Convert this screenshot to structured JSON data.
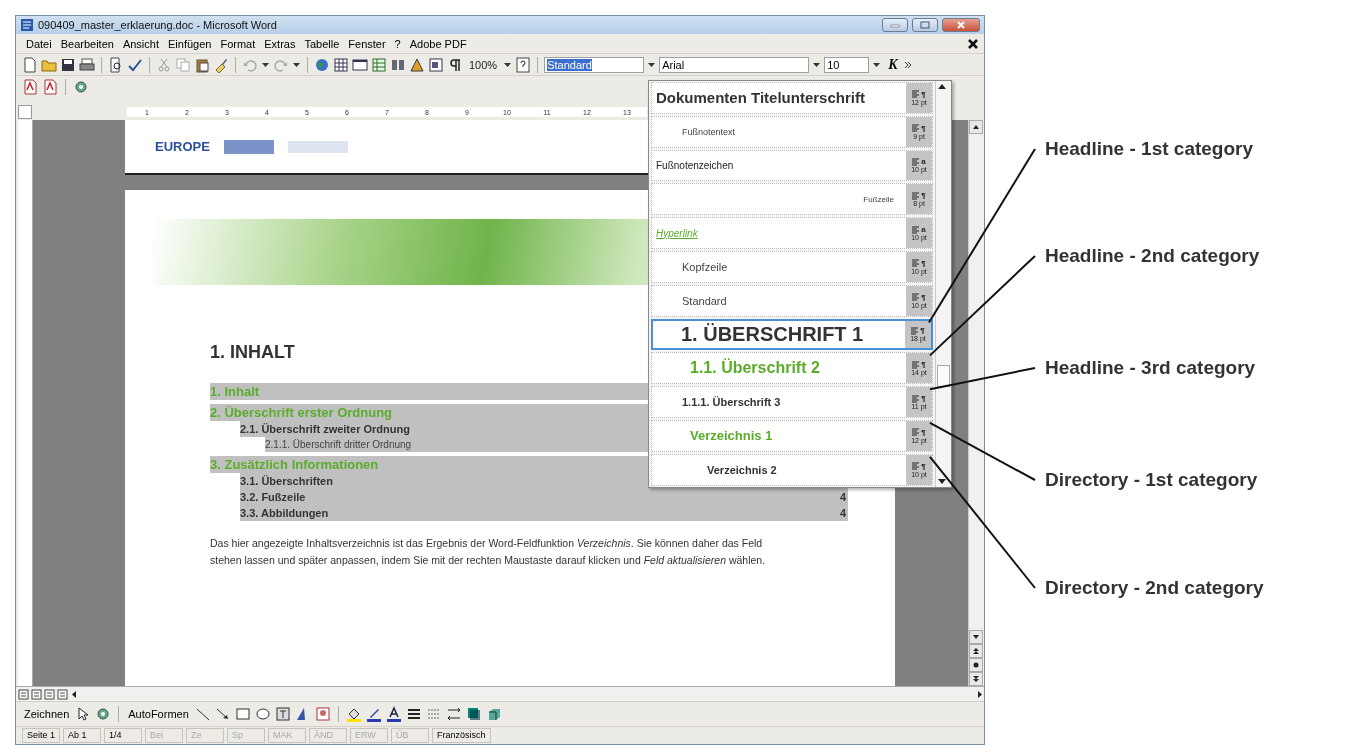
{
  "window": {
    "title": "090409_master_erklaerung.doc - Microsoft Word"
  },
  "menu": [
    "Datei",
    "Bearbeiten",
    "Ansicht",
    "Einfügen",
    "Format",
    "Extras",
    "Tabelle",
    "Fenster",
    "?",
    "Adobe PDF"
  ],
  "standard_toolbar": {
    "zoom": "100%"
  },
  "formatting_toolbar": {
    "style": "Standard",
    "font": "Arial",
    "size": "10",
    "italic_button": "K"
  },
  "ruler": {
    "marks": [
      "1",
      "2",
      "3",
      "4",
      "5",
      "6",
      "7",
      "8",
      "9",
      "10",
      "11",
      "12",
      "13"
    ]
  },
  "document": {
    "logo_text": "EUROPE",
    "heading": "1. INHALT",
    "toc": [
      {
        "text": "1. Inhalt"
      },
      {
        "text": "2. Überschrift erster Ordnung",
        "children": [
          {
            "text": "2.1. Überschrift zweiter Ordnung",
            "children": [
              {
                "text": "2.1.1. Überschrift dritter Ordnung"
              }
            ]
          }
        ]
      },
      {
        "text": "3. Zusätzlich Informationen",
        "children": [
          {
            "text": "3.1. Überschriften"
          },
          {
            "text": "3.2. Fußzeile",
            "page": "4"
          },
          {
            "text": "3.3. Abbildungen",
            "page": "4"
          }
        ]
      }
    ],
    "paragraph": "Das hier angezeigte Inhaltsverzeichnis ist das Ergebnis der Word-Feldfunktion *Verzeichnis*. Sie können daher das Feld stehen lassen und später anpassen, indem Sie mit der rechten Maustaste darauf klicken und *Feld aktualisieren* wählen."
  },
  "style_list": {
    "items": [
      {
        "label": "Dokumenten Titelunterschrift",
        "kind": "title",
        "marker": "¶",
        "size": "12 pt",
        "selected": false
      },
      {
        "label": "Fußnotentext",
        "kind": "footnote-text",
        "marker": "¶",
        "size": "9 pt",
        "selected": false
      },
      {
        "label": "Fußnotenzeichen",
        "kind": "footnote-mark",
        "marker": "a",
        "size": "10 pt",
        "selected": false
      },
      {
        "label": "Fußzeile",
        "kind": "footer",
        "marker": "¶",
        "size": "8 pt",
        "selected": false
      },
      {
        "label": "Hyperlink",
        "kind": "hyperlink",
        "marker": "a",
        "size": "10 pt",
        "selected": false
      },
      {
        "label": "Kopfzeile",
        "kind": "header",
        "marker": "¶",
        "size": "10 pt",
        "selected": false
      },
      {
        "label": "Standard",
        "kind": "normal",
        "marker": "¶",
        "size": "10 pt",
        "selected": false
      },
      {
        "label": "1.  ÜBERSCHRIFT 1",
        "kind": "h1",
        "marker": "¶",
        "size": "18 pt",
        "selected": true
      },
      {
        "label": "1.1.  Überschrift 2",
        "kind": "h2",
        "marker": "¶",
        "size": "14 pt",
        "selected": false
      },
      {
        "label": "1.1.1.  Überschrift 3",
        "kind": "h3",
        "marker": "¶",
        "size": "11 pt",
        "selected": false
      },
      {
        "label": "Verzeichnis 1",
        "kind": "toc1",
        "marker": "¶",
        "size": "12 pt",
        "selected": false
      },
      {
        "label": "Verzeichnis 2",
        "kind": "toc2",
        "marker": "¶",
        "size": "10 pt",
        "selected": false
      }
    ]
  },
  "drawing_toolbar": {
    "draw_menu": "Zeichnen",
    "autoshapes_menu": "AutoFormen"
  },
  "status_bar": [
    {
      "text": "Seite 1",
      "disabled": false
    },
    {
      "text": "Ab 1",
      "disabled": false
    },
    {
      "text": "1/4",
      "disabled": false
    },
    {
      "text": "Bei",
      "disabled": true
    },
    {
      "text": "Ze",
      "disabled": true
    },
    {
      "text": "Sp",
      "disabled": true
    },
    {
      "text": "MAK",
      "disabled": true
    },
    {
      "text": "ÄND",
      "disabled": true
    },
    {
      "text": "ERW",
      "disabled": true
    },
    {
      "text": "ÜB",
      "disabled": true
    },
    {
      "text": "Französisch",
      "disabled": false
    }
  ],
  "annotations": [
    {
      "text": "Headline - 1st category"
    },
    {
      "text": "Headline - 2nd category"
    },
    {
      "text": "Headline - 3rd category"
    },
    {
      "text": "Directory - 1st category"
    },
    {
      "text": "Directory - 2nd category"
    }
  ]
}
